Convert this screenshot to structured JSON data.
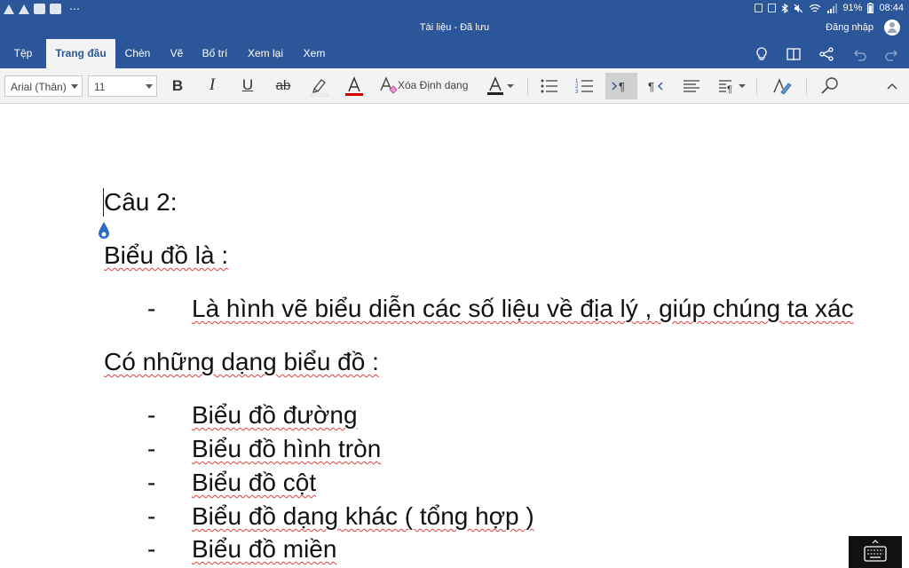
{
  "status_bar": {
    "battery": "91%",
    "time": "08:44",
    "overflow": "⋯"
  },
  "title_bar": {
    "title": "Tài liệu - Đã lưu",
    "sign_in": "Đăng nhập"
  },
  "ribbon": {
    "tabs": [
      {
        "label": "Tệp"
      },
      {
        "label": "Trang đầu",
        "active": true
      },
      {
        "label": "Chèn"
      },
      {
        "label": "Vẽ"
      },
      {
        "label": "Bố trí"
      },
      {
        "label": "Xem lại"
      },
      {
        "label": "Xem"
      }
    ],
    "right_icons": [
      "lightbulb-icon",
      "book-icon",
      "share-icon",
      "undo-icon",
      "redo-icon"
    ]
  },
  "toolbar": {
    "font_name": "Arial (Thân)",
    "font_size": "11",
    "bold": "B",
    "italic": "I",
    "underline": "U",
    "strikethrough": "ab",
    "clear_formatting": "Xóa Định dạng",
    "ltr_selected": true,
    "colors": {
      "font_color": "#cc0000",
      "highlight": "#ffffff",
      "ribbon_blue": "#2b579a"
    }
  },
  "document": {
    "heading": "Câu 2:",
    "line1": "Biểu đồ là :",
    "def_dash": "-",
    "definition": "Là hình vẽ biểu diễn các số liệu về địa lý , giúp chúng ta xác",
    "line2": "Có những dạng biểu đồ :",
    "list_dash": "-",
    "types": [
      "Biểu đồ đường",
      "Biểu đồ hình tròn",
      "Biểu đồ cột",
      "Biểu đồ dạng khác ( tổng hợp )",
      "Biểu đồ miền"
    ]
  }
}
